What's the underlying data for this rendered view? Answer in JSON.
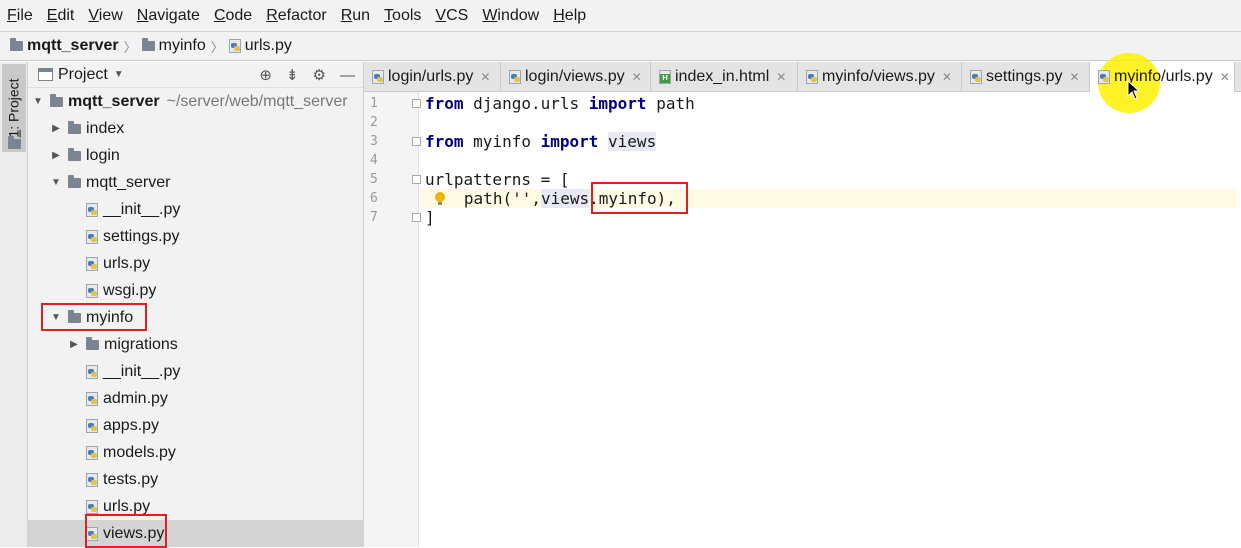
{
  "menu": {
    "items": [
      {
        "mnemonic": "F",
        "rest": "ile"
      },
      {
        "mnemonic": "E",
        "rest": "dit"
      },
      {
        "mnemonic": "V",
        "rest": "iew"
      },
      {
        "mnemonic": "N",
        "rest": "avigate"
      },
      {
        "mnemonic": "C",
        "rest": "ode"
      },
      {
        "mnemonic": "R",
        "rest": "efactor"
      },
      {
        "mnemonic": "R",
        "rest": "un",
        "pre": ""
      },
      {
        "mnemonic": "T",
        "rest": "ools"
      },
      {
        "mnemonic": "V",
        "rest": "CS"
      },
      {
        "mnemonic": "W",
        "rest": "indow"
      },
      {
        "mnemonic": "H",
        "rest": "elp"
      }
    ]
  },
  "breadcrumb": {
    "project": "mqtt_server",
    "folder": "myinfo",
    "file": "urls.py"
  },
  "left_stripe": {
    "tab_number": "1",
    "tab_label": ": Project"
  },
  "project_panel": {
    "title": "Project",
    "tree": [
      {
        "label": "mqtt_server",
        "hint": "~/server/web/mqtt_server"
      },
      {
        "label": "index"
      },
      {
        "label": "login"
      },
      {
        "label": "mqtt_server"
      },
      {
        "label": "__init__.py"
      },
      {
        "label": "settings.py"
      },
      {
        "label": "urls.py"
      },
      {
        "label": "wsgi.py"
      },
      {
        "label": "myinfo"
      },
      {
        "label": "migrations"
      },
      {
        "label": "__init__.py"
      },
      {
        "label": "admin.py"
      },
      {
        "label": "apps.py"
      },
      {
        "label": "models.py"
      },
      {
        "label": "tests.py"
      },
      {
        "label": "urls.py"
      },
      {
        "label": "views.py"
      }
    ]
  },
  "editor": {
    "tabs": [
      {
        "label": "login/urls.py",
        "icon": "python-file-icon"
      },
      {
        "label": "login/views.py",
        "icon": "python-file-icon"
      },
      {
        "label": "index_in.html",
        "icon": "html-file-icon"
      },
      {
        "label": "myinfo/views.py",
        "icon": "python-file-icon"
      },
      {
        "label": "settings.py",
        "icon": "python-file-icon"
      },
      {
        "label": "myinfo/urls.py",
        "icon": "python-file-icon",
        "active": true
      }
    ],
    "line_numbers": [
      "1",
      "2",
      "3",
      "4",
      "5",
      "6",
      "7"
    ],
    "code": {
      "l1_kw1": "from",
      "l1_mid": " django.urls ",
      "l1_kw2": "import",
      "l1_end": " path",
      "l3_kw1": "from",
      "l3_mid": " myinfo ",
      "l3_kw2": "import",
      "l3_ref": "views",
      "l5": "urlpatterns = [",
      "l6_a": " path(''",
      "l6_b": ",",
      "l6_ref": "views",
      "l6_c": ".myinfo),",
      "l7": "]"
    },
    "current_line": 6
  },
  "colors": {
    "keyword": "#000080",
    "annotation_box": "#e02020",
    "cursor_highlight": "#fff000",
    "current_line_bg": "#fffae3"
  }
}
